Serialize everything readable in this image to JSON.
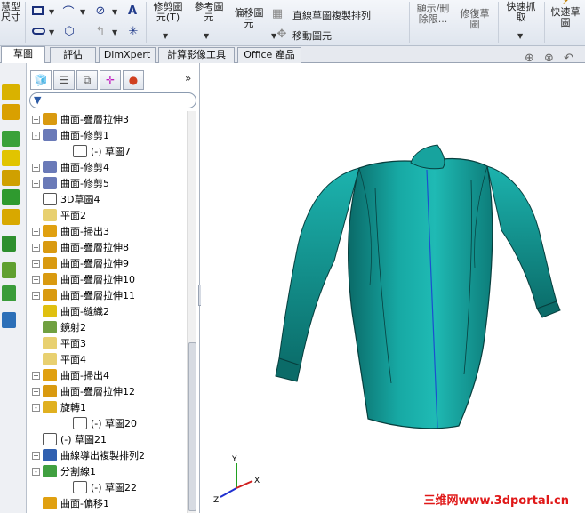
{
  "ribbon": {
    "smart_dim": "慧型\n尺寸",
    "trim": "修剪圖\n元(T)",
    "ref_entity": "參考圖\n元",
    "offset": "偏移圖\n元",
    "linear_pattern": "直線草圖複製排列",
    "move_entity": "移動圖元",
    "show_delete": "顯示/刪\n除限...",
    "repair": "修復草\n圖",
    "quick_snap": "快速抓\n取",
    "quick_sketch": "快速草\n圖"
  },
  "tabs": [
    "草圖",
    "評估",
    "DimXpert",
    "計算影像工具",
    "Office 產品"
  ],
  "tree": [
    {
      "label": "曲面-疊層拉伸3",
      "icon": "loft-surface-icon",
      "expand": "+",
      "depth": 0
    },
    {
      "label": "曲面-修剪1",
      "icon": "trim-surface-icon",
      "expand": "-",
      "depth": 0
    },
    {
      "label": "(-) 草圖7",
      "icon": "sketch-icon",
      "expand": "",
      "depth": 1
    },
    {
      "label": "曲面-修剪4",
      "icon": "trim-surface-icon",
      "expand": "+",
      "depth": 0
    },
    {
      "label": "曲面-修剪5",
      "icon": "trim-surface-icon",
      "expand": "+",
      "depth": 0
    },
    {
      "label": "3D草圖4",
      "icon": "3d-sketch-icon",
      "expand": "",
      "depth": 0
    },
    {
      "label": "平面2",
      "icon": "plane-icon",
      "expand": "",
      "depth": 0
    },
    {
      "label": "曲面-掃出3",
      "icon": "sweep-surface-icon",
      "expand": "+",
      "depth": 0
    },
    {
      "label": "曲面-疊層拉伸8",
      "icon": "loft-surface-icon",
      "expand": "+",
      "depth": 0
    },
    {
      "label": "曲面-疊層拉伸9",
      "icon": "loft-surface-icon",
      "expand": "+",
      "depth": 0
    },
    {
      "label": "曲面-疊層拉伸10",
      "icon": "loft-surface-icon",
      "expand": "+",
      "depth": 0
    },
    {
      "label": "曲面-疊層拉伸11",
      "icon": "loft-surface-icon",
      "expand": "+",
      "depth": 0
    },
    {
      "label": "曲面-縫織2",
      "icon": "knit-surface-icon",
      "expand": "",
      "depth": 0
    },
    {
      "label": "鏡射2",
      "icon": "mirror-icon",
      "expand": "",
      "depth": 0
    },
    {
      "label": "平面3",
      "icon": "plane-icon",
      "expand": "",
      "depth": 0
    },
    {
      "label": "平面4",
      "icon": "plane-icon",
      "expand": "",
      "depth": 0
    },
    {
      "label": "曲面-掃出4",
      "icon": "sweep-surface-icon",
      "expand": "+",
      "depth": 0
    },
    {
      "label": "曲面-疊層拉伸12",
      "icon": "loft-surface-icon",
      "expand": "+",
      "depth": 0
    },
    {
      "label": "旋轉1",
      "icon": "revolve-icon",
      "expand": "-",
      "depth": 0
    },
    {
      "label": "(-) 草圖20",
      "icon": "sketch-icon",
      "expand": "",
      "depth": 1
    },
    {
      "label": "(-) 草圖21",
      "icon": "sketch-icon",
      "expand": "",
      "depth": 0
    },
    {
      "label": "曲線導出複製排列2",
      "icon": "curve-pattern-icon",
      "expand": "+",
      "depth": 0
    },
    {
      "label": "分割線1",
      "icon": "split-line-icon",
      "expand": "-",
      "depth": 0
    },
    {
      "label": "(-) 草圖22",
      "icon": "sketch-icon",
      "expand": "",
      "depth": 1
    },
    {
      "label": "曲面-偏移1",
      "icon": "offset-surface-icon",
      "expand": "",
      "depth": 0
    }
  ],
  "watermark": "三维网www.3dportal.cn",
  "triad": {
    "x": "X",
    "y": "Y",
    "z": "Z"
  }
}
